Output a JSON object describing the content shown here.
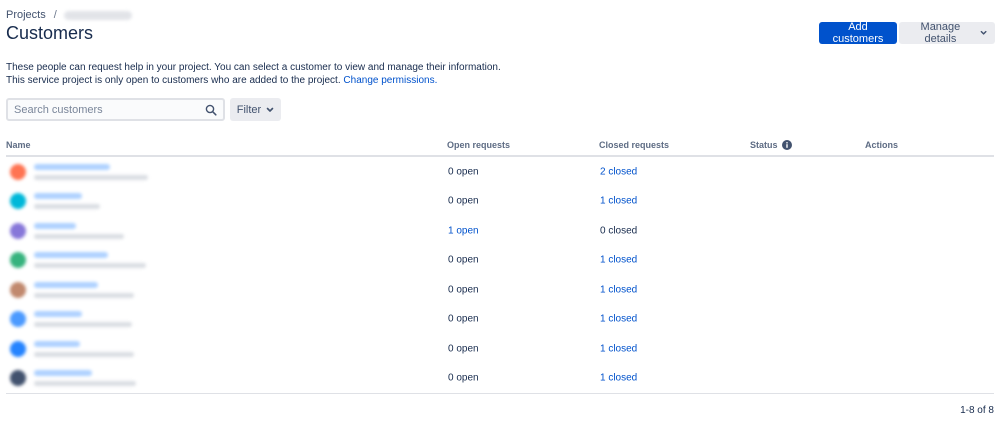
{
  "breadcrumb": {
    "projects": "Projects",
    "separator": "/"
  },
  "header": {
    "title": "Customers",
    "add_customers": "Add customers",
    "manage_details": "Manage details"
  },
  "description": {
    "line1": "These people can request help in your project. You can select a customer to view and manage their information.",
    "line2": "This service project is only open to customers who are added to the project.",
    "link": "Change permissions."
  },
  "search": {
    "placeholder": "Search customers",
    "value": ""
  },
  "filter": {
    "label": "Filter"
  },
  "table": {
    "columns": {
      "name": "Name",
      "open": "Open requests",
      "closed": "Closed requests",
      "status": "Status",
      "actions": "Actions"
    },
    "rows": [
      {
        "open": "0 open",
        "closed": "2 closed",
        "open_link": false,
        "closed_link": true,
        "avatar_color": "#ff7452"
      },
      {
        "open": "0 open",
        "closed": "1 closed",
        "open_link": false,
        "closed_link": true,
        "avatar_color": "#00b8d9"
      },
      {
        "open": "1 open",
        "closed": "0 closed",
        "open_link": true,
        "closed_link": false,
        "avatar_color": "#8777d9"
      },
      {
        "open": "0 open",
        "closed": "1 closed",
        "open_link": false,
        "closed_link": true,
        "avatar_color": "#36b37e"
      },
      {
        "open": "0 open",
        "closed": "1 closed",
        "open_link": false,
        "closed_link": true,
        "avatar_color": "#c1896e"
      },
      {
        "open": "0 open",
        "closed": "1 closed",
        "open_link": false,
        "closed_link": true,
        "avatar_color": "#4c9aff"
      },
      {
        "open": "0 open",
        "closed": "1 closed",
        "open_link": false,
        "closed_link": true,
        "avatar_color": "#2684ff"
      },
      {
        "open": "0 open",
        "closed": "1 closed",
        "open_link": false,
        "closed_link": true,
        "avatar_color": "#42526e"
      }
    ]
  },
  "pagination": {
    "text": "1-8 of 8"
  },
  "colors": {
    "primary": "#0052cc",
    "link": "#0052cc",
    "text": "#172b4d"
  },
  "icons": {
    "search": "search-icon",
    "chevron": "chevron-down-icon",
    "info": "info-icon"
  }
}
